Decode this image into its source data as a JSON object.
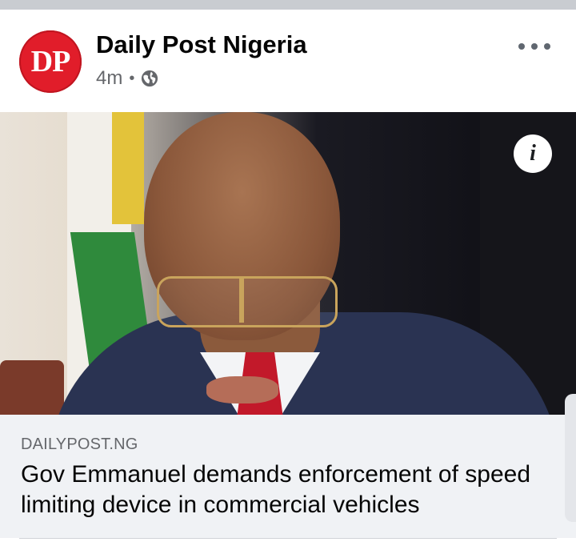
{
  "post": {
    "page_name": "Daily Post Nigeria",
    "avatar_text": "DP",
    "time_ago": "4m",
    "separator": "•",
    "audience_icon": "globe-icon",
    "more_icon": "more-options-icon"
  },
  "media": {
    "info_icon_label": "i"
  },
  "link": {
    "domain": "DAILYPOST.NG",
    "headline": "Gov Emmanuel demands enforcement of speed limiting device in commercial vehicles"
  },
  "colors": {
    "avatar_bg": "#e11d2a",
    "link_bg": "#f0f2f5",
    "secondary_text": "#65676b"
  }
}
